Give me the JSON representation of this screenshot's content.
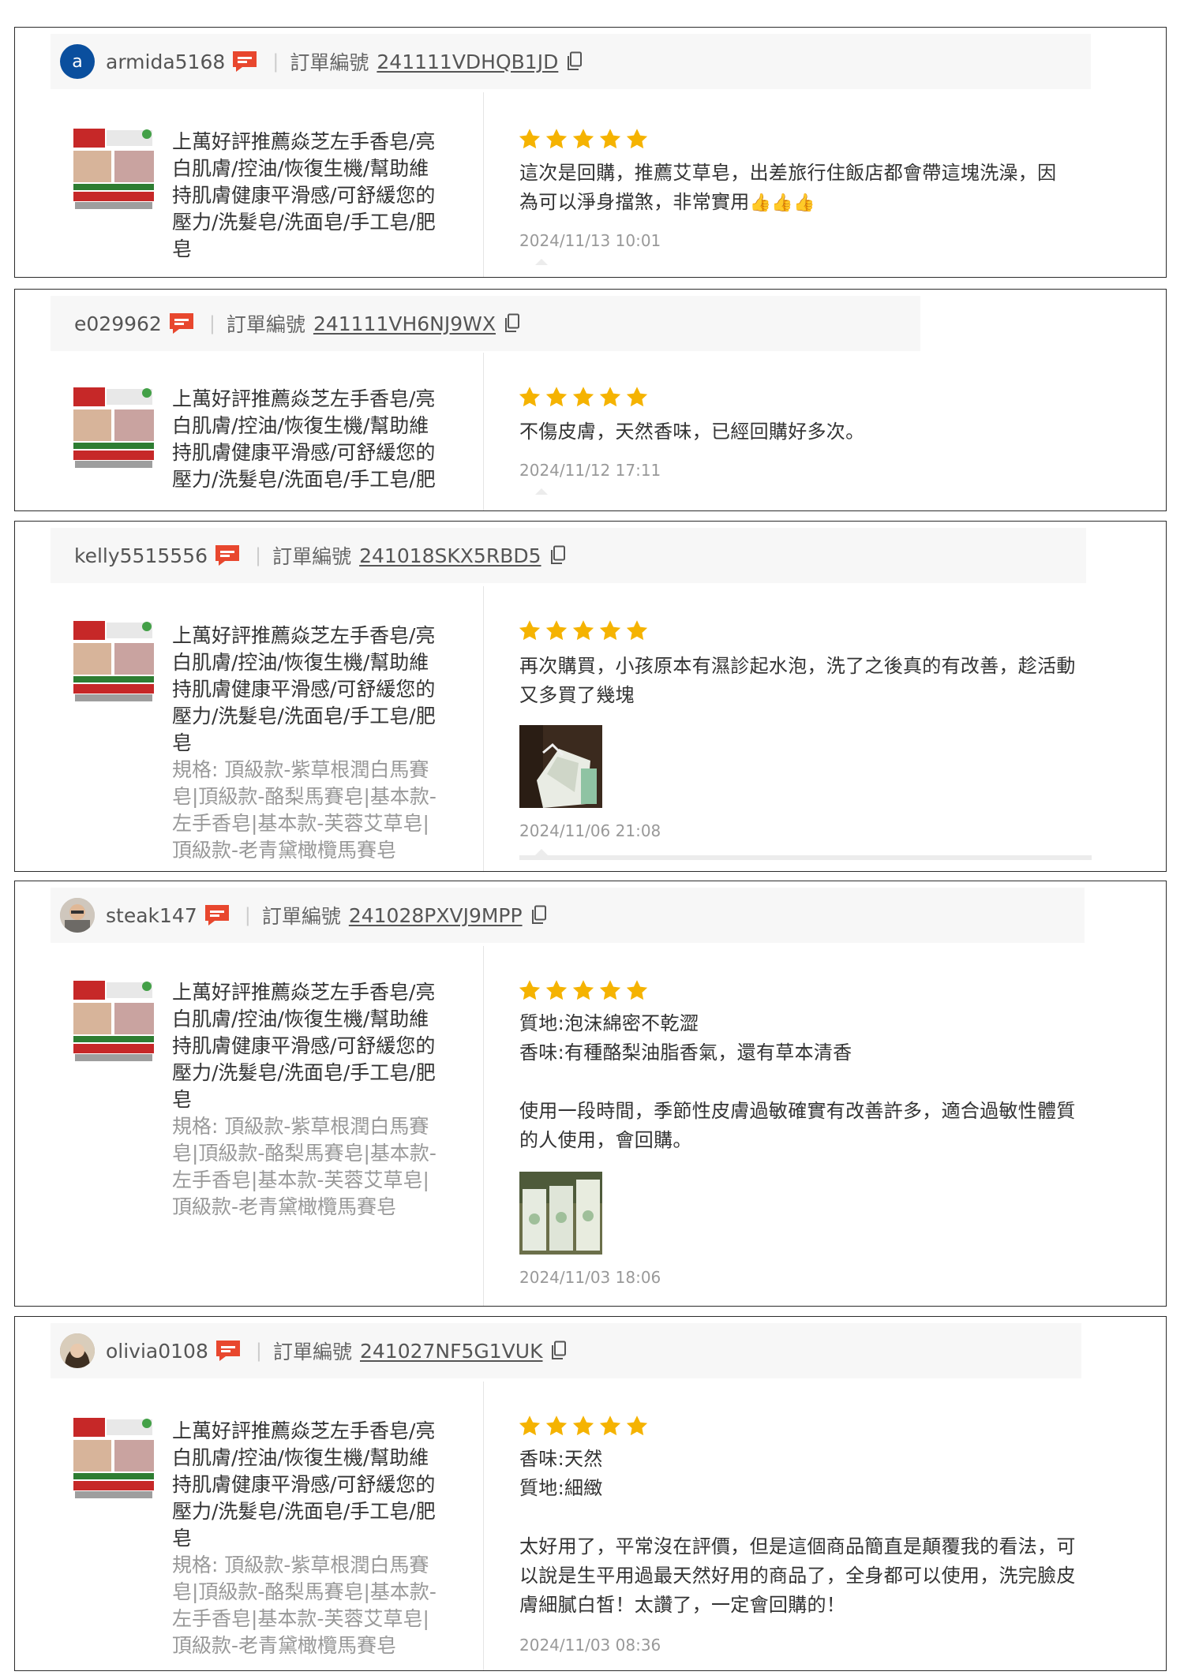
{
  "labels": {
    "order": "訂單編號"
  },
  "product": {
    "title": "上萬好評推薦焱芝左手香皂/亮白肌膚/控油/恢復生機/幫助維持肌膚健康平滑感/可舒緩您的壓力/洗髮皂/洗面皂/手工皂/肥皂",
    "title_truncated": "上萬好評推薦焱芝左手香皂/亮白肌膚/控油/恢復生機/幫助維持肌膚健康平滑感/可舒緩您的壓力/洗髮皂/洗面皂/手工皂/肥",
    "spec": "規格: 頂級款-紫草根潤白馬賽皂|頂級款-酪梨馬賽皂|基本款-左手香皂|基本款-芙蓉艾草皂|頂級款-老青黛橄欖馬賽皂"
  },
  "colors": {
    "star": "#f5b301",
    "chat": "#e8472e",
    "avatar_a": "#0a4f9e"
  },
  "reviews": [
    {
      "username": "armida5168",
      "avatar_letter": "a",
      "order_id": "241111VDHQB1JD",
      "rating": 5,
      "text": "這次是回購，推薦艾草皂，出差旅行住飯店都會帶這塊洗澡，因為可以淨身擋煞，非常實用",
      "emoji": "👍👍👍",
      "date": "2024/11/13 10:01"
    },
    {
      "username": "e029962",
      "order_id": "241111VH6NJ9WX",
      "rating": 5,
      "text": "不傷皮膚，天然香味，已經回購好多次。",
      "date": "2024/11/12 17:11"
    },
    {
      "username": "kelly5515556",
      "order_id": "241018SKX5RBD5",
      "rating": 5,
      "text": "再次購買，小孩原本有濕診起水泡，洗了之後真的有改善，趁活動又多買了幾塊",
      "date": "2024/11/06 21:08"
    },
    {
      "username": "steak147",
      "order_id": "241028PXVJ9MPP",
      "rating": 5,
      "text": "質地:泡沫綿密不乾澀\n香味:有種酪梨油脂香氣，還有草本清香\n\n使用一段時間，季節性皮膚過敏確實有改善許多，適合過敏性體質的人使用，會回購。",
      "date": "2024/11/03 18:06"
    },
    {
      "username": "olivia0108",
      "order_id": "241027NF5G1VUK",
      "rating": 5,
      "text": "香味:天然\n質地:細緻\n\n太好用了，平常沒在評價，但是這個商品簡直是顛覆我的看法，可以說是生平用過最天然好用的商品了，全身都可以使用，洗完臉皮膚細膩白皙！太讚了，一定會回購的！",
      "date": "2024/11/03 08:36"
    }
  ]
}
